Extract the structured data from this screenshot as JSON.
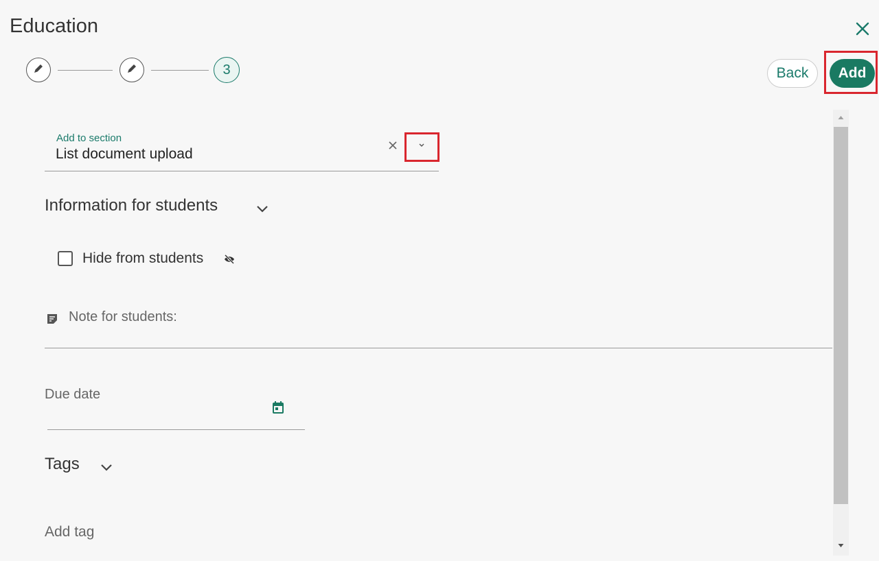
{
  "header": {
    "title": "Education"
  },
  "stepper": {
    "current_step": "3"
  },
  "actions": {
    "back_label": "Back",
    "add_label": "Add"
  },
  "section_select": {
    "label": "Add to section",
    "value": "List document upload"
  },
  "info_section": {
    "heading": "Information for students"
  },
  "hide": {
    "label": "Hide from students",
    "checked": false
  },
  "note": {
    "placeholder": "Note for students:"
  },
  "due_date": {
    "placeholder": "Due date"
  },
  "tags": {
    "heading": "Tags",
    "placeholder": "Add tag"
  },
  "colors": {
    "accent": "#1a7a62",
    "highlight": "#d9262e"
  },
  "icons": [
    "close-icon",
    "pencil-icon",
    "chevron-down-icon",
    "eye-off-icon",
    "note-icon",
    "calendar-icon"
  ]
}
